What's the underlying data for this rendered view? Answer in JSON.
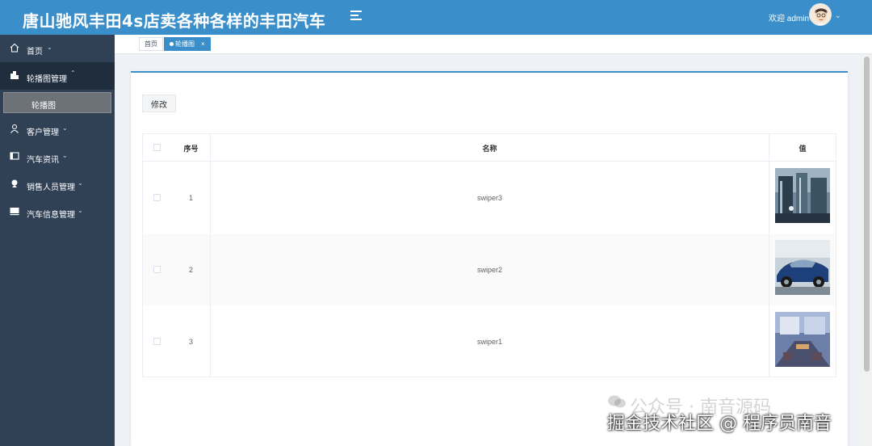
{
  "header": {
    "title": "唐山驰风丰田4s店卖各种各样的丰田汽车",
    "welcome": "欢迎 admin"
  },
  "sidebar": {
    "items": [
      {
        "label": "首页",
        "icon": "home-icon"
      },
      {
        "label": "轮播图管理",
        "icon": "building-icon",
        "expanded": true
      },
      {
        "label": "客户管理",
        "icon": "user-icon"
      },
      {
        "label": "汽车资讯",
        "icon": "news-icon"
      },
      {
        "label": "销售人员管理",
        "icon": "person-badge-icon"
      },
      {
        "label": "汽车信息管理",
        "icon": "monitor-icon"
      }
    ],
    "sub_item": "轮播图"
  },
  "tabs": [
    {
      "label": "首页",
      "active": false
    },
    {
      "label": "轮播图",
      "active": true
    }
  ],
  "toolbar": {
    "edit_label": "修改"
  },
  "table": {
    "columns": [
      "序号",
      "名称",
      "值"
    ],
    "rows": [
      {
        "index": "1",
        "name": "swiper3"
      },
      {
        "index": "2",
        "name": "swiper2"
      },
      {
        "index": "3",
        "name": "swiper1"
      }
    ]
  },
  "watermark": {
    "line1": "公众号 · 南音源码",
    "line2": "掘金技术社区 @ 程序员南音"
  },
  "colors": {
    "header": "#3a8fca",
    "sidebar": "#304156",
    "active_tab": "#3a8fca"
  }
}
